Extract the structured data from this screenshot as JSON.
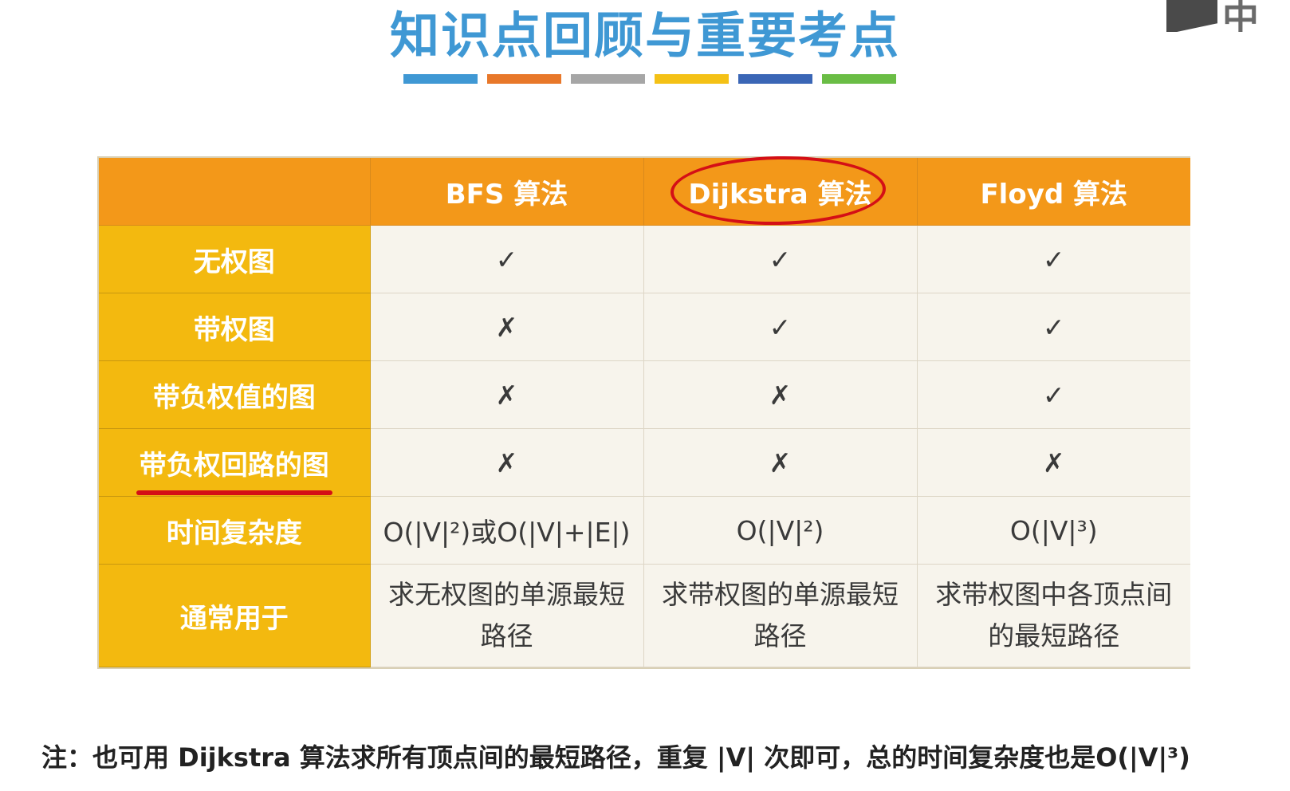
{
  "title": "知识点回顾与重要考点",
  "logo_text": "中国",
  "color_bar": [
    "#3f98d4",
    "#e8782a",
    "#a6a6a6",
    "#f4c116",
    "#3a66b6",
    "#6abd45"
  ],
  "table": {
    "headers": [
      "",
      "BFS 算法",
      "Dijkstra 算法",
      "Floyd 算法"
    ],
    "rows": [
      {
        "label": "无权图",
        "cells": [
          "✓",
          "✓",
          "✓"
        ]
      },
      {
        "label": "带权图",
        "cells": [
          "✗",
          "✓",
          "✓"
        ]
      },
      {
        "label": "带负权值的图",
        "cells": [
          "✗",
          "✗",
          "✓"
        ]
      },
      {
        "label": "带负权回路的图",
        "cells": [
          "✗",
          "✗",
          "✗"
        ]
      },
      {
        "label": "时间复杂度",
        "cells": [
          "O(|V|²)或O(|V|+|E|)",
          "O(|V|²)",
          "O(|V|³)"
        ]
      },
      {
        "label": "通常用于",
        "cells": [
          "求无权图的单源最短路径",
          "求带权图的单源最短路径",
          "求带权图中各顶点间的最短路径"
        ]
      }
    ]
  },
  "note": "注：也可用 Dijkstra 算法求所有顶点间的最短路径，重复 |V| 次即可，总的时间复杂度也是O(|V|³)"
}
